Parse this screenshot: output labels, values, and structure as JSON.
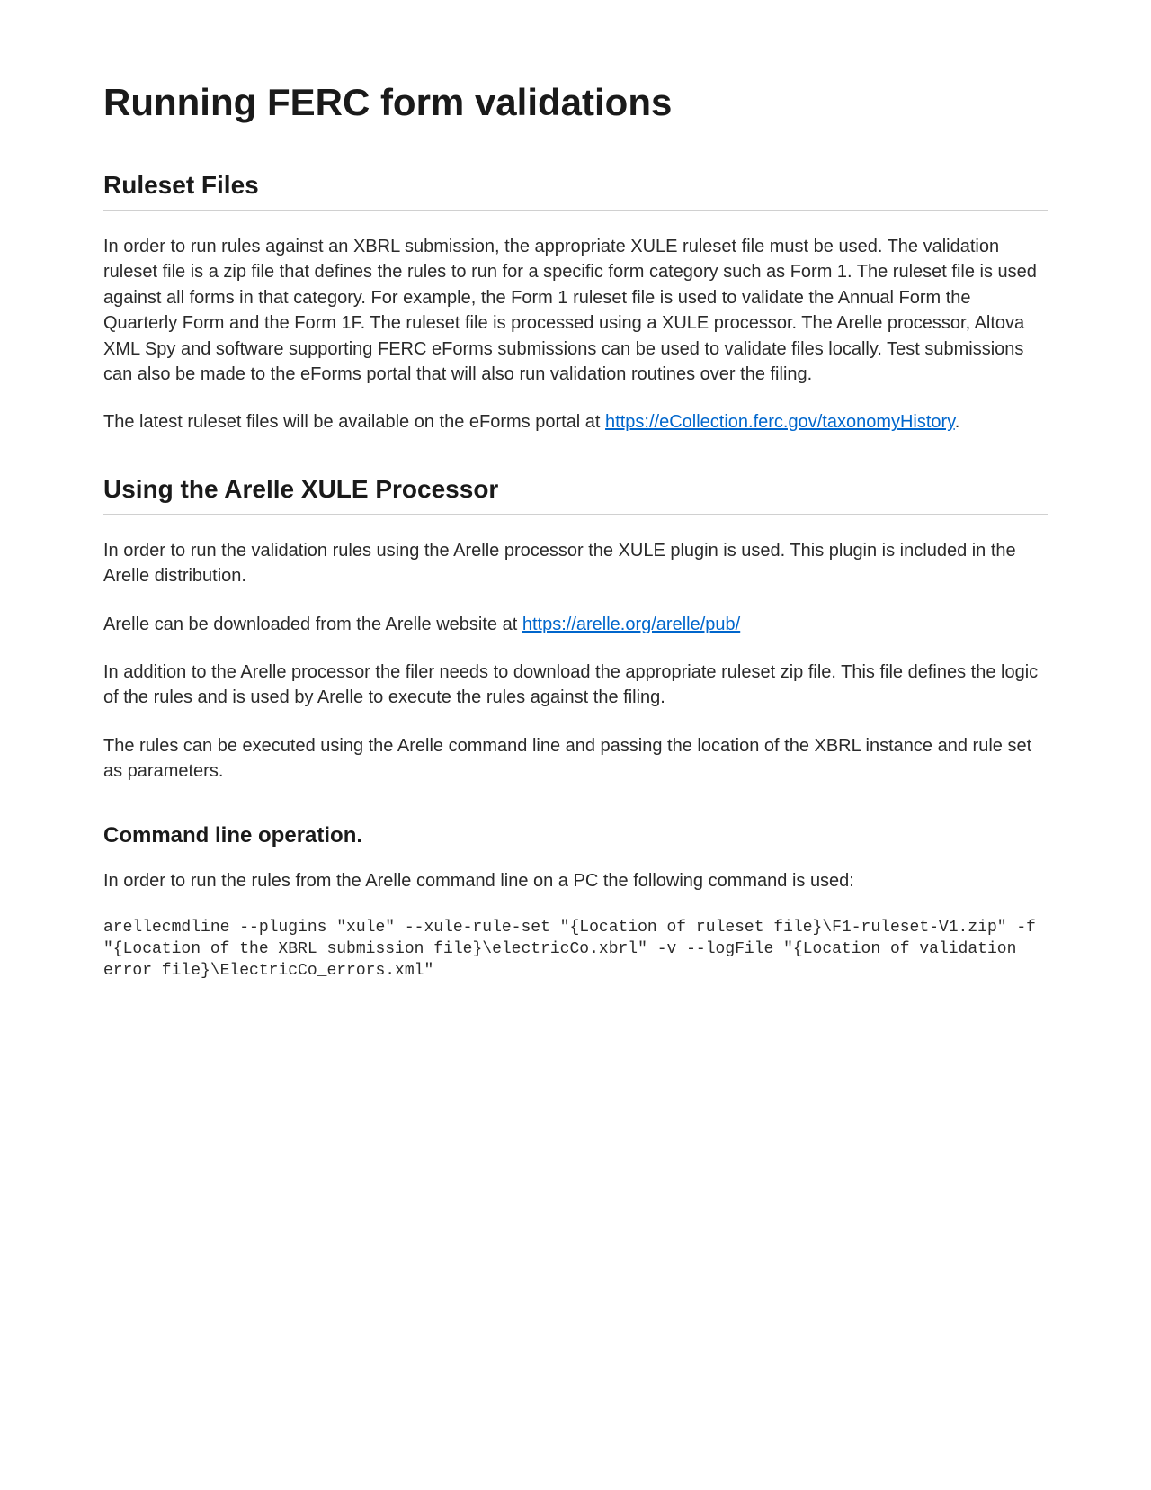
{
  "title": "Running FERC form validations",
  "section1": {
    "heading": "Ruleset Files",
    "para1": "In order to run rules against an XBRL submission, the appropriate XULE ruleset file must be used. The validation ruleset file is a zip file that defines the rules to run for a specific form category such as Form 1. The ruleset file is used against all forms in that category. For example, the Form 1 ruleset file is used to validate the Annual Form the Quarterly Form and the Form 1F. The ruleset file is processed using a XULE processor. The Arelle processor, Altova XML Spy and software supporting FERC eForms submissions can be used to validate files locally. Test submissions can also be made to the eForms portal that will also run validation routines over the filing.",
    "para2_prefix": "The latest ruleset files will be available on the eForms portal at  ",
    "para2_link_text": "https://eCollection.ferc.gov/taxonomyHistory",
    "para2_link_href": "https://eCollection.ferc.gov/taxonomyHistory",
    "para2_suffix": "."
  },
  "section2": {
    "heading": "Using the Arelle XULE Processor",
    "para1": "In order to run the validation rules using the Arelle processor the XULE plugin is used. This plugin is included in the Arelle distribution.",
    "para2_prefix": "Arelle can be downloaded from the Arelle website at ",
    "para2_link_text": "https://arelle.org/arelle/pub/",
    "para2_link_href": "https://arelle.org/arelle/pub/",
    "para3": "In addition to the Arelle processor the filer needs to download the appropriate ruleset zip file. This file defines the logic of the rules and is used by Arelle to execute the rules against the filing.",
    "para4": "The rules can be executed using the Arelle command line and passing the location of the XBRL instance and rule set as parameters."
  },
  "section3": {
    "heading": "Command line operation.",
    "para1": "In order to run the rules from the Arelle command line on a PC the following command is used:",
    "code": "arellecmdline --plugins \"xule\" --xule-rule-set \"{Location of ruleset file}\\F1-ruleset-V1.zip\" -f \"{Location of the XBRL submission file}\\electricCo.xbrl\" -v --logFile \"{Location of validation error file}\\ElectricCo_errors.xml\""
  }
}
